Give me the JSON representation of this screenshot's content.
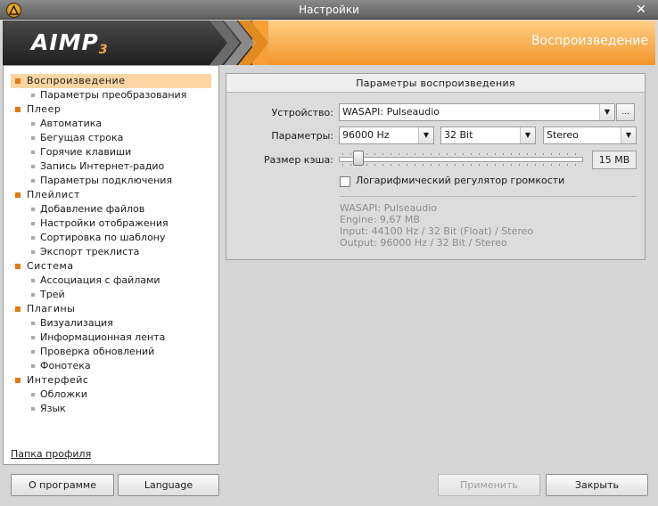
{
  "window": {
    "title": "Настройки",
    "close_glyph": "✕"
  },
  "header": {
    "logo_text": "AIMP",
    "logo_sub": "3",
    "section_title": "Воспроизведение"
  },
  "sidebar": {
    "items": [
      {
        "label": "Воспроизведение",
        "level": 0,
        "selected": true
      },
      {
        "label": "Параметры преобразования",
        "level": 1
      },
      {
        "label": "Плеер",
        "level": 0
      },
      {
        "label": "Автоматика",
        "level": 1
      },
      {
        "label": "Бегущая строка",
        "level": 1
      },
      {
        "label": "Горячие клавиши",
        "level": 1
      },
      {
        "label": "Запись Интернет-радио",
        "level": 1
      },
      {
        "label": "Параметры подключения",
        "level": 1
      },
      {
        "label": "Плейлист",
        "level": 0
      },
      {
        "label": "Добавление файлов",
        "level": 1
      },
      {
        "label": "Настройки отображения",
        "level": 1
      },
      {
        "label": "Сортировка по шаблону",
        "level": 1
      },
      {
        "label": "Экспорт треклиста",
        "level": 1
      },
      {
        "label": "Система",
        "level": 0
      },
      {
        "label": "Ассоциация с файлами",
        "level": 1
      },
      {
        "label": "Трей",
        "level": 1
      },
      {
        "label": "Плагины",
        "level": 0
      },
      {
        "label": "Визуализация",
        "level": 1
      },
      {
        "label": "Информационная лента",
        "level": 1
      },
      {
        "label": "Проверка обновлений",
        "level": 1
      },
      {
        "label": "Фонотека",
        "level": 1
      },
      {
        "label": "Интерфейс",
        "level": 0
      },
      {
        "label": "Обложки",
        "level": 1
      },
      {
        "label": "Язык",
        "level": 1
      }
    ],
    "profile_link": "Папка профиля"
  },
  "playback": {
    "group_title": "Параметры воспроизведения",
    "device_label": "Устройство:",
    "device_value": "WASAPI: Pulseaudio",
    "device_more": "...",
    "params_label": "Параметры:",
    "samplerate_value": "96000 Hz",
    "bits_value": "32 Bit",
    "channels_value": "Stereo",
    "cache_label": "Размер кэша:",
    "cache_value": "15 MB",
    "cache_level": 0.06,
    "log_volume_label": "Логарифмический регулятор громкости",
    "log_volume_checked": false,
    "info": [
      "WASAPI: Pulseaudio",
      "Engine: 9,67 MB",
      "Input: 44100 Hz / 32 Bit (Float) / Stereo",
      "Output: 96000 Hz / 32 Bit / Stereo"
    ]
  },
  "buttons": {
    "about": "О программе",
    "language": "Language",
    "apply": "Применить",
    "close": "Закрыть"
  },
  "colors": {
    "accent": "#f7a03a",
    "selection": "#fbd5a3",
    "bullet": "#e07a10"
  }
}
